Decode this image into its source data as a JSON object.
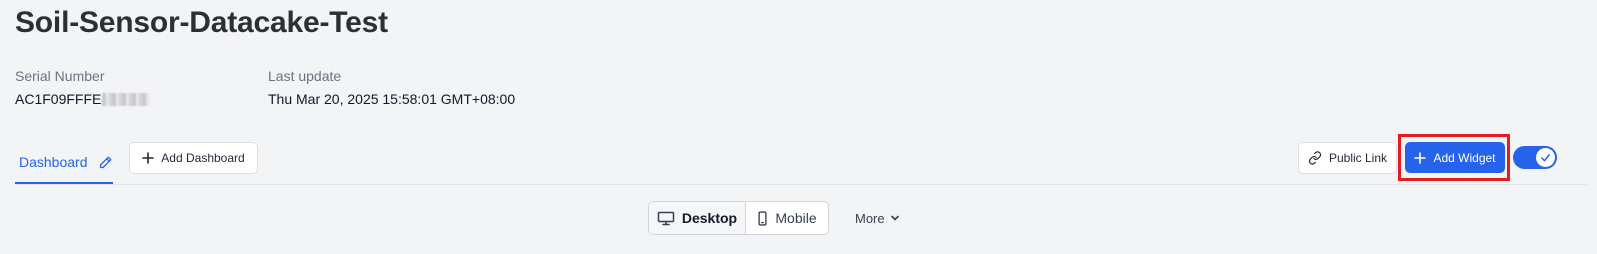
{
  "page": {
    "title": "Soil-Sensor-Datacake-Test"
  },
  "meta": {
    "serial_label": "Serial Number",
    "serial_value": "AC1F09FFFE",
    "last_update_label": "Last update",
    "last_update_value": "Thu Mar 20, 2025 15:58:01 GMT+08:00"
  },
  "tabs": {
    "active_label": "Dashboard",
    "add_dashboard_label": "Add Dashboard"
  },
  "toolbar": {
    "public_link_label": "Public Link",
    "add_widget_label": "Add Widget",
    "edit_toggle_on": true
  },
  "view": {
    "desktop_label": "Desktop",
    "mobile_label": "Mobile",
    "selected": "Desktop",
    "more_label": "More"
  },
  "icons": {
    "edit": "pencil-icon",
    "add": "plus-icon",
    "link": "link-icon",
    "desktop": "monitor-icon",
    "mobile": "phone-icon",
    "more": "chevron-down-icon",
    "toggle": "check-icon"
  },
  "colors": {
    "accent": "#2563eb",
    "highlight": "#e11d1d",
    "background": "#f3f4f6"
  }
}
